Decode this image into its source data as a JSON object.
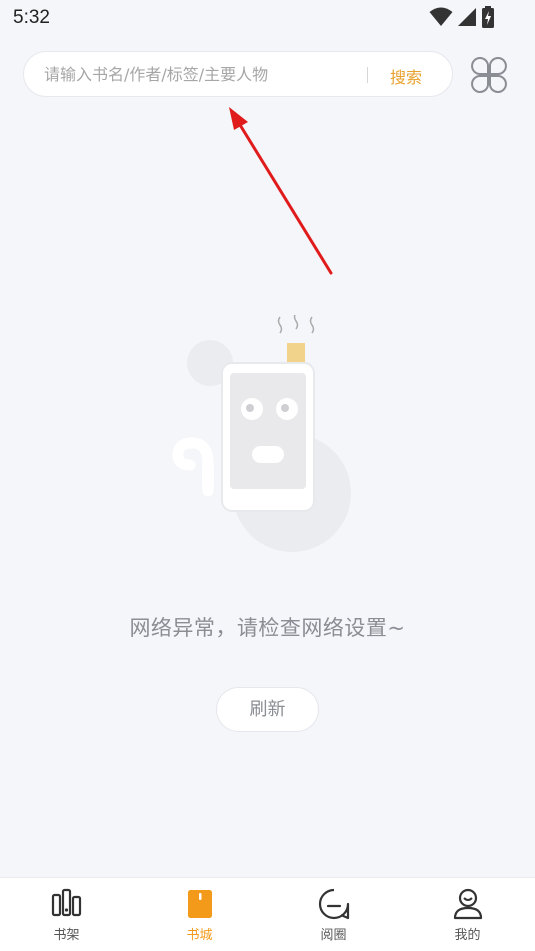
{
  "status_bar": {
    "time": "5:32"
  },
  "search": {
    "placeholder": "请输入书名/作者/标签/主要人物",
    "value": "",
    "button_label": "搜索",
    "accent_color": "#e8a12e"
  },
  "empty_state": {
    "message": "网络异常，请检查网络设置~",
    "refresh_label": "刷新"
  },
  "bottom_nav": {
    "active_color": "#f39a1a",
    "items": [
      {
        "label": "书架",
        "icon": "bookshelf-icon"
      },
      {
        "label": "书城",
        "icon": "bookstore-icon"
      },
      {
        "label": "阅圈",
        "icon": "reading-circle-icon"
      },
      {
        "label": "我的",
        "icon": "profile-icon"
      }
    ]
  }
}
